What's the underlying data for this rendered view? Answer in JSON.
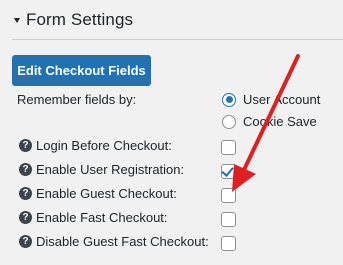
{
  "section": {
    "title": "Form Settings"
  },
  "edit_button": {
    "label": "Edit Checkout Fields"
  },
  "remember": {
    "label": "Remember fields by:",
    "options": [
      {
        "label": "User Account",
        "selected": true
      },
      {
        "label": "Cookie Save",
        "selected": false
      }
    ]
  },
  "fields": [
    {
      "label": "Login Before Checkout:",
      "checked": false
    },
    {
      "label": "Enable User Registration:",
      "checked": true
    },
    {
      "label": "Enable Guest Checkout:",
      "checked": false
    },
    {
      "label": "Enable Fast Checkout:",
      "checked": false
    },
    {
      "label": "Disable Guest Fast Checkout:",
      "checked": false
    }
  ],
  "colors": {
    "accent": "#2271b1",
    "arrow": "#e02020"
  },
  "icons": {
    "help": "question-circle-icon",
    "collapse": "triangle-down-icon"
  }
}
